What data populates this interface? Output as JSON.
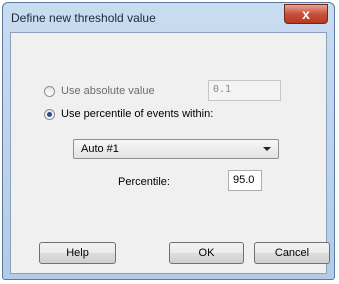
{
  "window": {
    "title": "Define new threshold value",
    "close_glyph": "x"
  },
  "options": {
    "absolute": {
      "label": "Use absolute value",
      "value": "0.1",
      "checked": false
    },
    "percentile": {
      "label": "Use percentile of events within:",
      "checked": true
    }
  },
  "events_select": {
    "selected": "Auto #1"
  },
  "percentile_field": {
    "label": "Percentile:",
    "value": "95.0"
  },
  "buttons": {
    "help": "Help",
    "ok": "OK",
    "cancel": "Cancel"
  }
}
